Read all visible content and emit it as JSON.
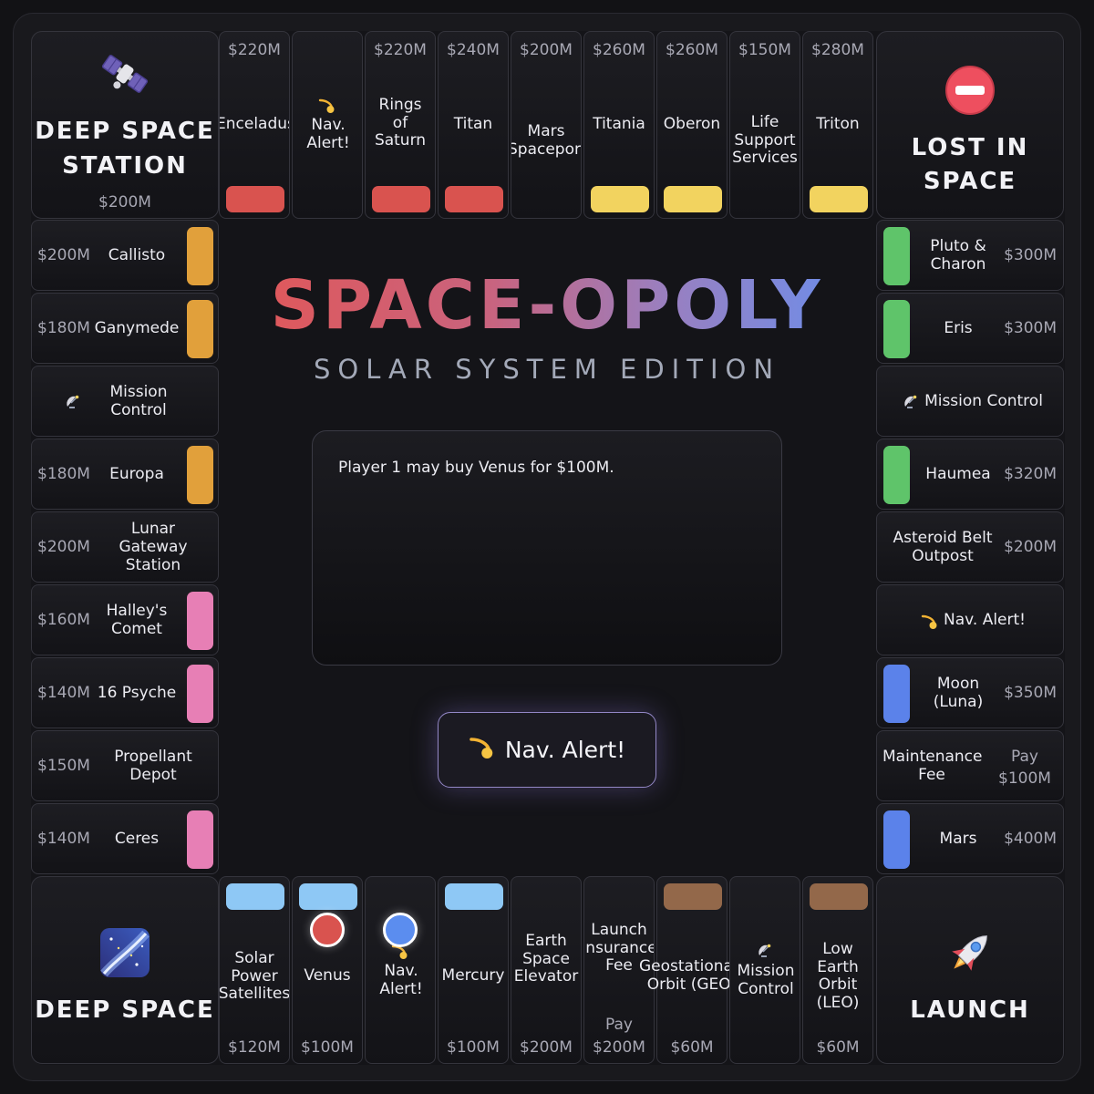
{
  "game": {
    "title": "SPACE-OPOLY",
    "subtitle": "SOLAR SYSTEM EDITION",
    "log_message": "Player 1 may buy Venus for $100M.",
    "card_button_label": "Nav. Alert!",
    "card_button_icon": "comet-icon"
  },
  "corners": {
    "top_left": {
      "title_line1": "DEEP SPACE",
      "title_line2": "STATION",
      "price": "$200M",
      "icon": "satellite-icon"
    },
    "top_right": {
      "title_line1": "LOST IN",
      "title_line2": "SPACE",
      "icon": "no-entry-icon"
    },
    "bottom_left": {
      "title": "DEEP SPACE",
      "icon": "milky-way-icon"
    },
    "bottom_right": {
      "title": "LAUNCH",
      "icon": "rocket-icon"
    }
  },
  "top_row": [
    {
      "price": "$220M",
      "name": "Enceladus",
      "color": "#d9534f"
    },
    {
      "name": "Nav. Alert!",
      "icon": "comet-icon"
    },
    {
      "price": "$220M",
      "name": "Rings of Saturn",
      "color": "#d9534f"
    },
    {
      "price": "$240M",
      "name": "Titan",
      "color": "#d9534f"
    },
    {
      "price": "$200M",
      "name": "Mars Spaceport"
    },
    {
      "price": "$260M",
      "name": "Titania",
      "color": "#f2d35f"
    },
    {
      "price": "$260M",
      "name": "Oberon",
      "color": "#f2d35f"
    },
    {
      "price": "$150M",
      "name": "Life Support Services"
    },
    {
      "price": "$280M",
      "name": "Triton",
      "color": "#f2d35f"
    }
  ],
  "bottom_row": [
    {
      "name": "Solar Power Satellites",
      "price": "$120M",
      "color": "#8ec8f5"
    },
    {
      "name": "Venus",
      "price": "$100M",
      "color": "#8ec8f5",
      "token": "#d9534f"
    },
    {
      "name": "Nav. Alert!",
      "icon": "comet-icon",
      "token": "#5b8def"
    },
    {
      "name": "Mercury",
      "price": "$100M",
      "color": "#8ec8f5"
    },
    {
      "name": "Earth Space Elevator",
      "price": "$200M"
    },
    {
      "name": "Launch Insurance Fee",
      "sub": "Pay",
      "price": "$200M"
    },
    {
      "name": "Geostationary Orbit (GEO)",
      "price": "$60M",
      "color": "#93684a"
    },
    {
      "name": "Mission Control",
      "icon": "satellite-dish-icon"
    },
    {
      "name": "Low Earth Orbit (LEO)",
      "price": "$60M",
      "color": "#93684a"
    }
  ],
  "left_col": [
    {
      "price": "$200M",
      "name": "Callisto",
      "color": "#e1a03b"
    },
    {
      "price": "$180M",
      "name": "Ganymede",
      "color": "#e1a03b"
    },
    {
      "name": "Mission Control",
      "icon": "satellite-dish-icon"
    },
    {
      "price": "$180M",
      "name": "Europa",
      "color": "#e1a03b"
    },
    {
      "price": "$200M",
      "name": "Lunar Gateway Station"
    },
    {
      "price": "$160M",
      "name": "Halley's Comet",
      "color": "#e77fb5"
    },
    {
      "price": "$140M",
      "name": "16 Psyche",
      "color": "#e77fb5"
    },
    {
      "price": "$150M",
      "name": "Propellant Depot"
    },
    {
      "price": "$140M",
      "name": "Ceres",
      "color": "#e77fb5"
    }
  ],
  "right_col": [
    {
      "name": "Pluto & Charon",
      "price": "$300M",
      "color": "#5fc46a"
    },
    {
      "name": "Eris",
      "price": "$300M",
      "color": "#5fc46a"
    },
    {
      "name": "Mission Control",
      "icon": "satellite-dish-icon"
    },
    {
      "name": "Haumea",
      "price": "$320M",
      "color": "#5fc46a"
    },
    {
      "name": "Asteroid Belt Outpost",
      "price": "$200M"
    },
    {
      "name": "Nav. Alert!",
      "icon": "comet-icon"
    },
    {
      "name": "Moon (Luna)",
      "price": "$350M",
      "color": "#5b82ea"
    },
    {
      "name": "Maintenance Fee",
      "sub": "Pay",
      "price": "$100M"
    },
    {
      "name": "Mars",
      "price": "$400M",
      "color": "#5b82ea"
    }
  ]
}
